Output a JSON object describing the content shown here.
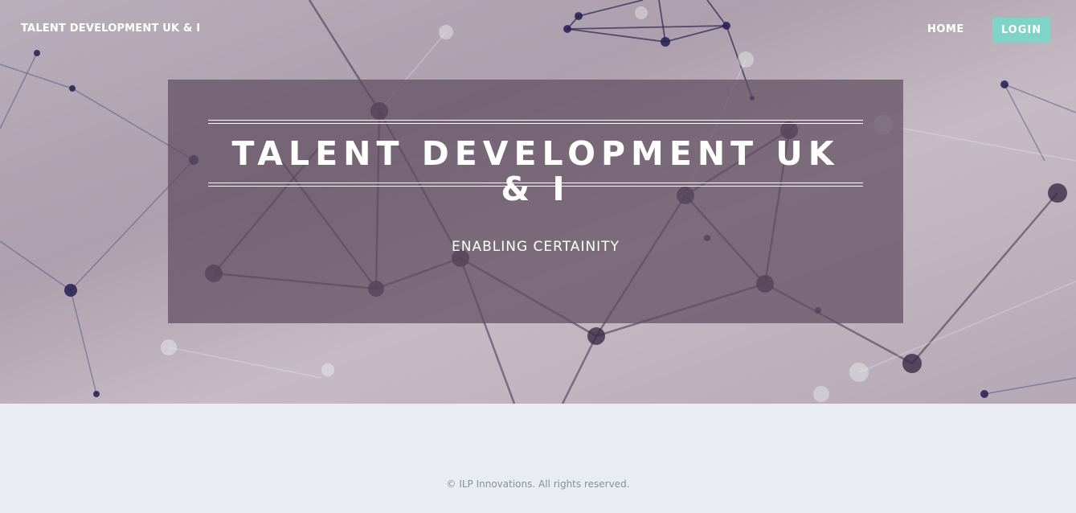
{
  "nav": {
    "brand": "TALENT DEVELOPMENT UK & I",
    "home_label": "HOME",
    "login_label": "LOGIN"
  },
  "hero": {
    "title": "TALENT DEVELOPMENT UK & I",
    "tagline": "ENABLING CERTAINITY"
  },
  "footer": {
    "copyright": "© ILP Innovations. All rights reserved."
  },
  "colors": {
    "login_button": "#7fd3c7",
    "panel_overlay": "#604e5f",
    "footer_bg": "#e9edf3"
  }
}
